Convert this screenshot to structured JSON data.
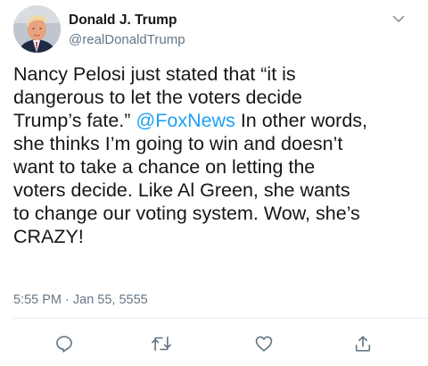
{
  "author": {
    "name": "Donald J. Trump",
    "handle": "@realDonaldTrump"
  },
  "tweet": {
    "line1": "Nancy Pelosi just stated that “it is",
    "line2": "dangerous to let the voters decide",
    "line3_before": "Trump’s fate.” ",
    "mention": "@FoxNews",
    "line3_after": " In other words,",
    "line4": "she thinks I’m going to win and doesn’t",
    "line5": "want to take a chance on letting the",
    "line6": "voters decide. Like Al Green, she wants",
    "line7": "to change our voting system. Wow, she’s",
    "line8": "CRAZY!"
  },
  "timestamp": "5:55 PM · Jan 55, 5555",
  "icons": {
    "menu": "chevron-down-icon",
    "reply": "reply-icon",
    "retweet": "retweet-icon",
    "like": "heart-icon",
    "share": "share-icon"
  },
  "colors": {
    "text": "#14171a",
    "secondary": "#657786",
    "mention": "#1da1f2",
    "divider": "#e6ecf0"
  }
}
